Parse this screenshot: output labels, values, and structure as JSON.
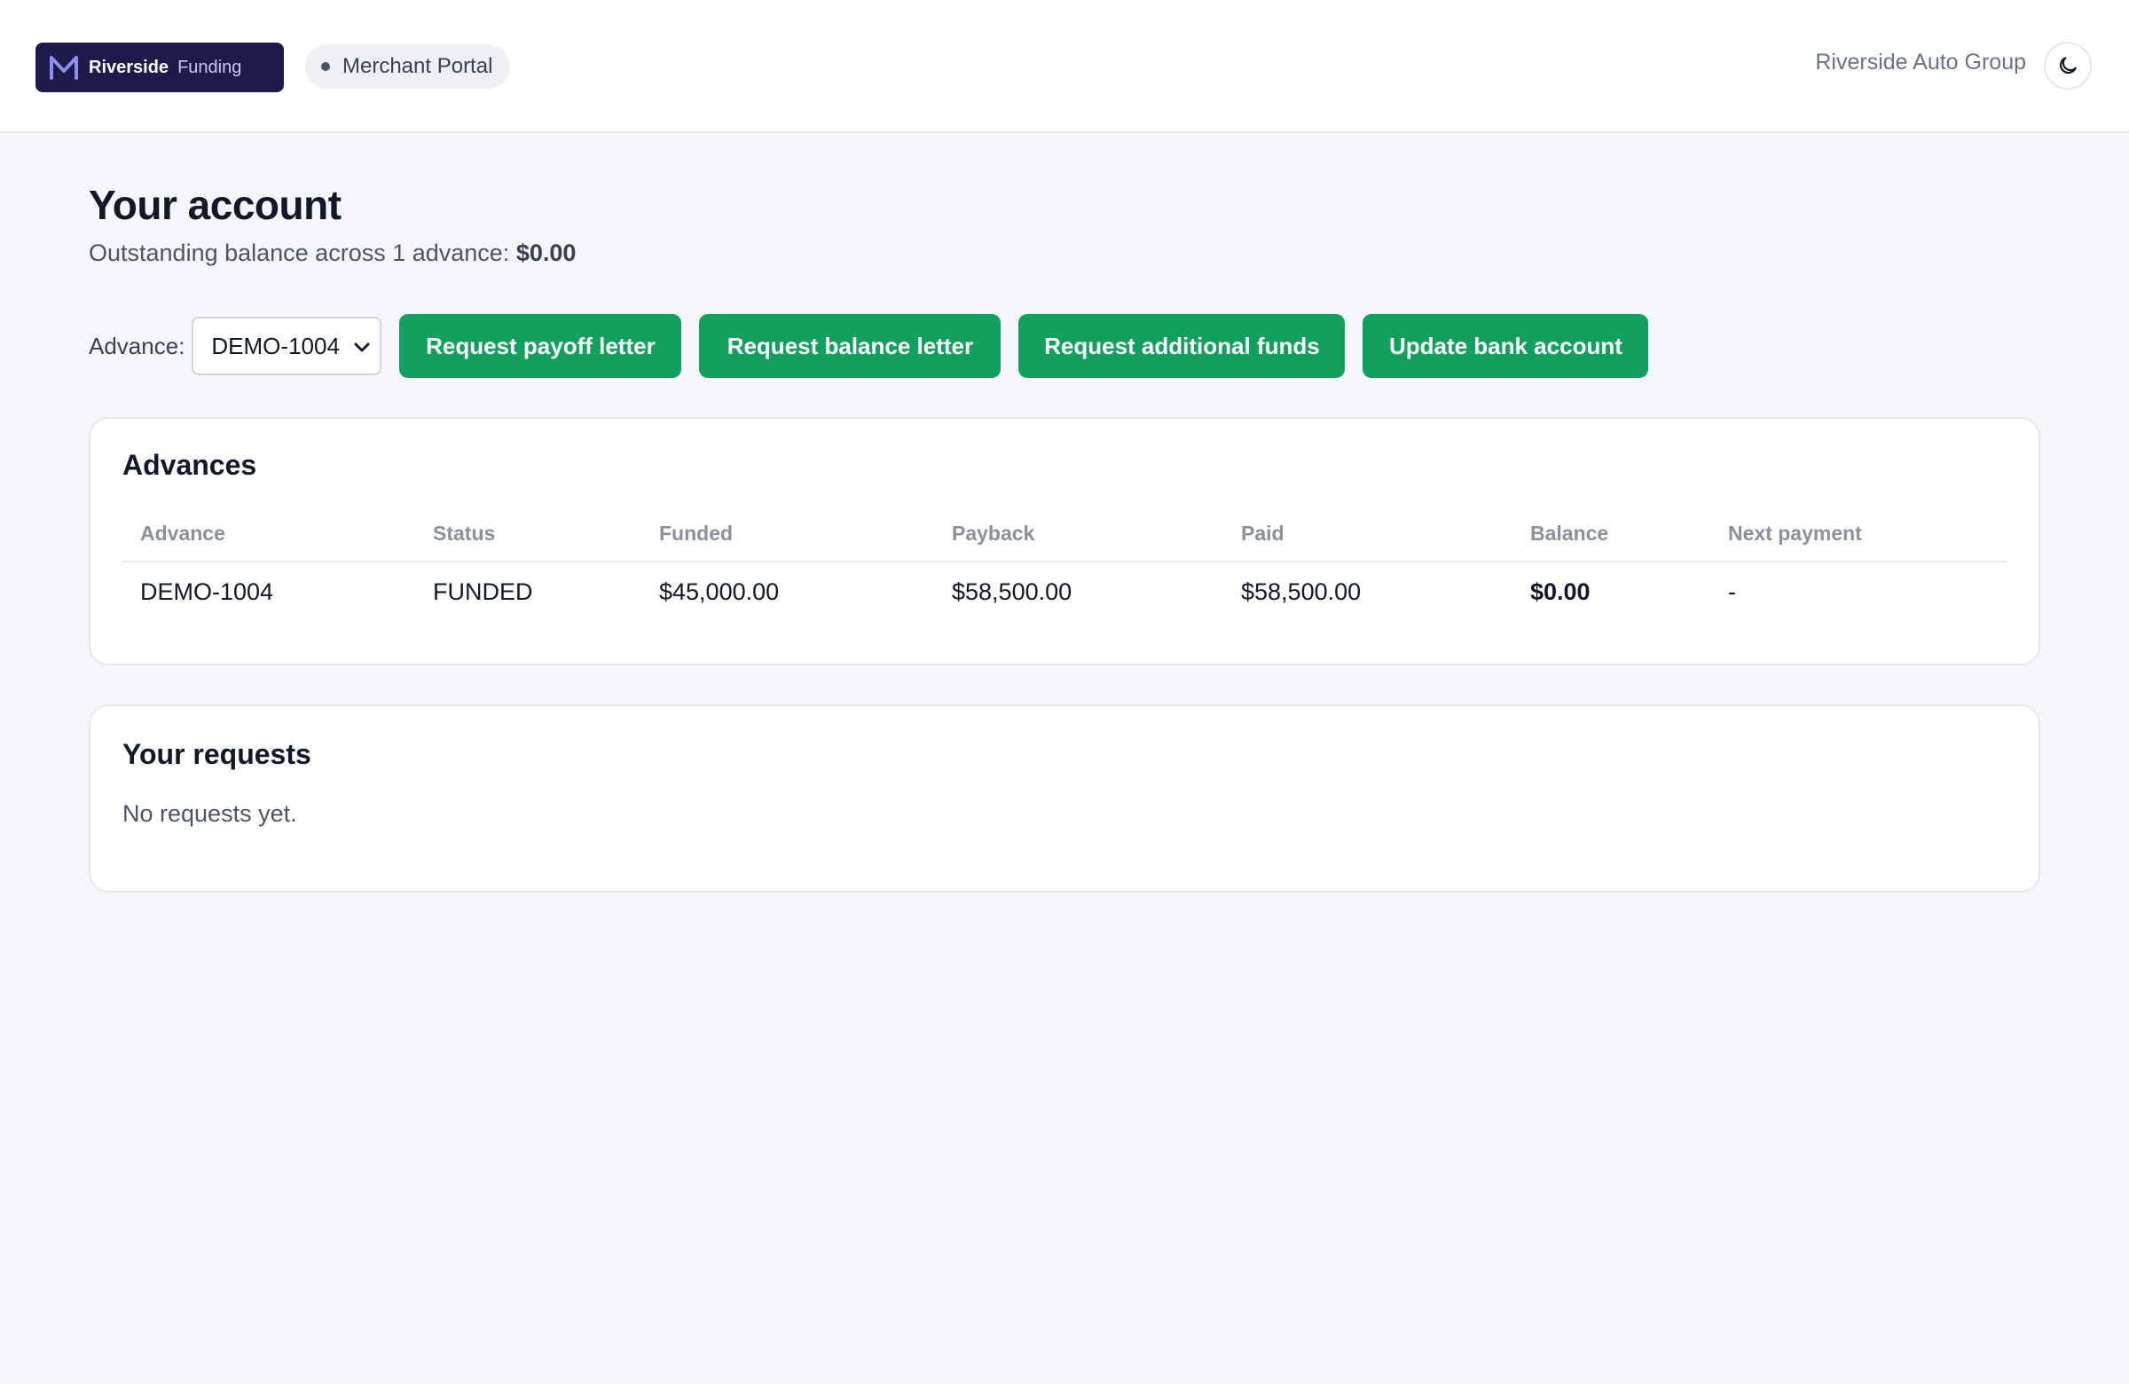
{
  "brand": {
    "name": "Riverside",
    "suffix": "Funding",
    "logo_icon": "m-logo-icon",
    "color": "#1e1b4b"
  },
  "header": {
    "portal_label": "Merchant Portal",
    "merchant_name": "Riverside Auto Group",
    "theme_icon": "moon-icon"
  },
  "account": {
    "title": "Your account",
    "subtitle_prefix": "Outstanding balance across 1 advance:",
    "subtitle_amount": "$0.00"
  },
  "actions": {
    "advance_label": "Advance:",
    "selected_advance": "DEMO-1004",
    "buttons": [
      "Request payoff letter",
      "Request balance letter",
      "Request additional funds",
      "Update bank account"
    ],
    "accent": "#12a05f"
  },
  "advances": {
    "title": "Advances",
    "columns": [
      "Advance",
      "Status",
      "Funded",
      "Payback",
      "Paid",
      "Balance",
      "Next payment"
    ],
    "rows": [
      [
        "DEMO-1004",
        "FUNDED",
        "$45,000.00",
        "$58,500.00",
        "$58,500.00",
        "$0.00",
        "-"
      ]
    ]
  },
  "requests": {
    "title": "Your requests",
    "empty_message": "No requests yet."
  }
}
